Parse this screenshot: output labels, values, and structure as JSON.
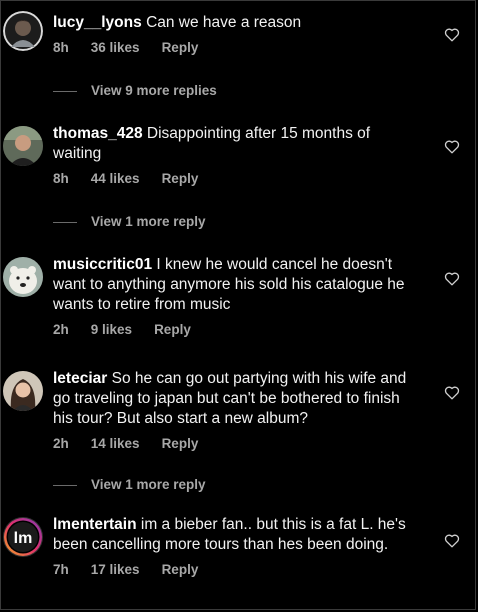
{
  "comments": [
    {
      "username": "lucy__lyons",
      "text": "Can we have a reason",
      "time": "8h",
      "likes": "36 likes",
      "reply": "Reply",
      "more_replies": "View 9 more replies"
    },
    {
      "username": "thomas_428",
      "text": "Disappointing after 15 months of waiting",
      "time": "8h",
      "likes": "44 likes",
      "reply": "Reply",
      "more_replies": "View 1 more reply"
    },
    {
      "username": "musiccritic01",
      "text": "I knew he would cancel he doesn't want to anything anymore his sold his catalogue he wants to retire from music",
      "time": "2h",
      "likes": "9 likes",
      "reply": "Reply"
    },
    {
      "username": "leteciar",
      "text": "So he can go out partying with his wife and go traveling to japan but can't be bothered to finish his tour? But also start a new album?",
      "time": "2h",
      "likes": "14 likes",
      "reply": "Reply",
      "more_replies": "View 1 more reply"
    },
    {
      "username": "lmentertain",
      "text": "im a bieber fan.. but this is a fat L. he's been cancelling more tours than hes been doing.",
      "time": "7h",
      "likes": "17 likes",
      "reply": "Reply",
      "avatar_text": "lm"
    }
  ],
  "icons": {
    "like": "heart-outline-icon"
  },
  "colors": {
    "background": "#000000",
    "text": "#f2f2f2",
    "muted": "#a8a8a8"
  }
}
